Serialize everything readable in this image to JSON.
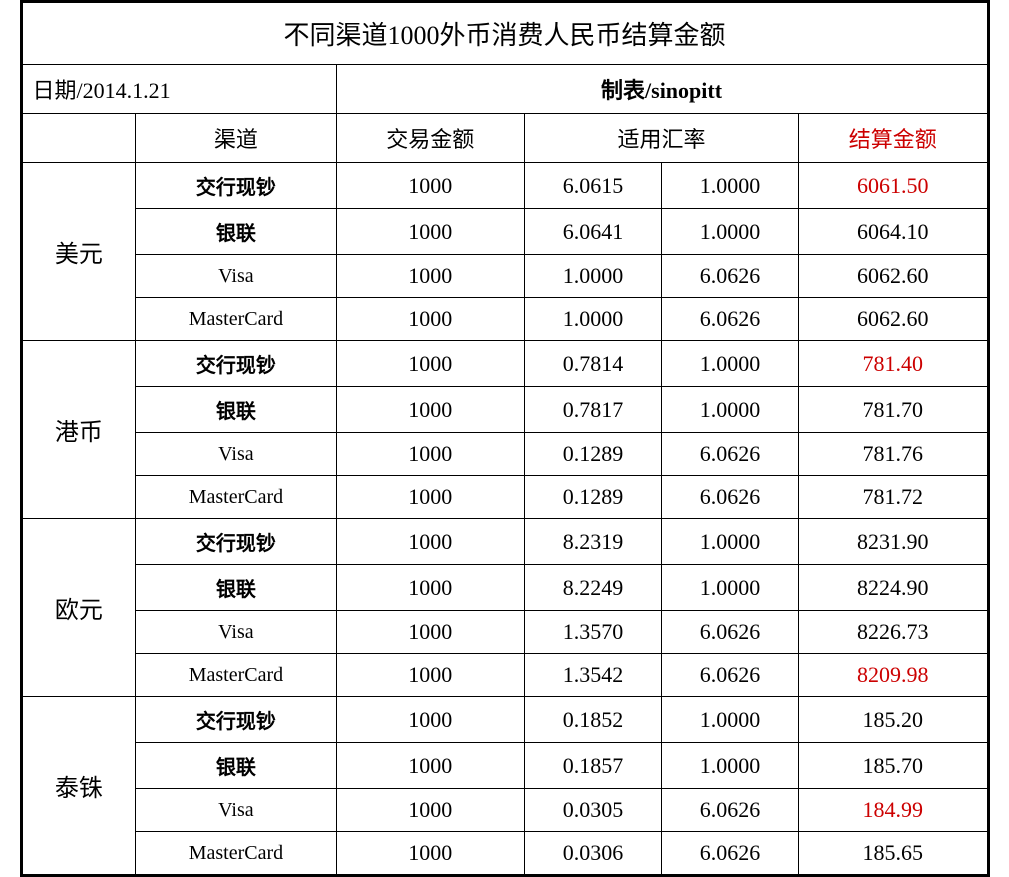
{
  "title": "不同渠道1000外币消费人民币结算金额",
  "meta": {
    "date_label": "日期/2014.1.21",
    "maker_label": "制表/sinopitt"
  },
  "headers": {
    "currency": "",
    "channel": "渠道",
    "amount": "交易金额",
    "rate1": "适用汇率",
    "rate2": "",
    "settlement": "结算金额"
  },
  "currencies": [
    {
      "name": "美元",
      "rows": [
        {
          "channel": "交行现钞",
          "amount": "1000",
          "rate1": "6.0615",
          "rate2": "1.0000",
          "settlement": "6061.50",
          "red": true
        },
        {
          "channel": "银联",
          "amount": "1000",
          "rate1": "6.0641",
          "rate2": "1.0000",
          "settlement": "6064.10",
          "red": false
        },
        {
          "channel": "Visa",
          "amount": "1000",
          "rate1": "1.0000",
          "rate2": "6.0626",
          "settlement": "6062.60",
          "red": false
        },
        {
          "channel": "MasterCard",
          "amount": "1000",
          "rate1": "1.0000",
          "rate2": "6.0626",
          "settlement": "6062.60",
          "red": false
        }
      ]
    },
    {
      "name": "港币",
      "rows": [
        {
          "channel": "交行现钞",
          "amount": "1000",
          "rate1": "0.7814",
          "rate2": "1.0000",
          "settlement": "781.40",
          "red": true
        },
        {
          "channel": "银联",
          "amount": "1000",
          "rate1": "0.7817",
          "rate2": "1.0000",
          "settlement": "781.70",
          "red": false
        },
        {
          "channel": "Visa",
          "amount": "1000",
          "rate1": "0.1289",
          "rate2": "6.0626",
          "settlement": "781.76",
          "red": false
        },
        {
          "channel": "MasterCard",
          "amount": "1000",
          "rate1": "0.1289",
          "rate2": "6.0626",
          "settlement": "781.72",
          "red": false
        }
      ]
    },
    {
      "name": "欧元",
      "rows": [
        {
          "channel": "交行现钞",
          "amount": "1000",
          "rate1": "8.2319",
          "rate2": "1.0000",
          "settlement": "8231.90",
          "red": false
        },
        {
          "channel": "银联",
          "amount": "1000",
          "rate1": "8.2249",
          "rate2": "1.0000",
          "settlement": "8224.90",
          "red": false
        },
        {
          "channel": "Visa",
          "amount": "1000",
          "rate1": "1.3570",
          "rate2": "6.0626",
          "settlement": "8226.73",
          "red": false
        },
        {
          "channel": "MasterCard",
          "amount": "1000",
          "rate1": "1.3542",
          "rate2": "6.0626",
          "settlement": "8209.98",
          "red": true
        }
      ]
    },
    {
      "name": "泰铢",
      "rows": [
        {
          "channel": "交行现钞",
          "amount": "1000",
          "rate1": "0.1852",
          "rate2": "1.0000",
          "settlement": "185.20",
          "red": false
        },
        {
          "channel": "银联",
          "amount": "1000",
          "rate1": "0.1857",
          "rate2": "1.0000",
          "settlement": "185.70",
          "red": false
        },
        {
          "channel": "Visa",
          "amount": "1000",
          "rate1": "0.0305",
          "rate2": "6.0626",
          "settlement": "184.99",
          "red": true
        },
        {
          "channel": "MasterCard",
          "amount": "1000",
          "rate1": "0.0306",
          "rate2": "6.0626",
          "settlement": "185.65",
          "red": false
        }
      ]
    }
  ]
}
